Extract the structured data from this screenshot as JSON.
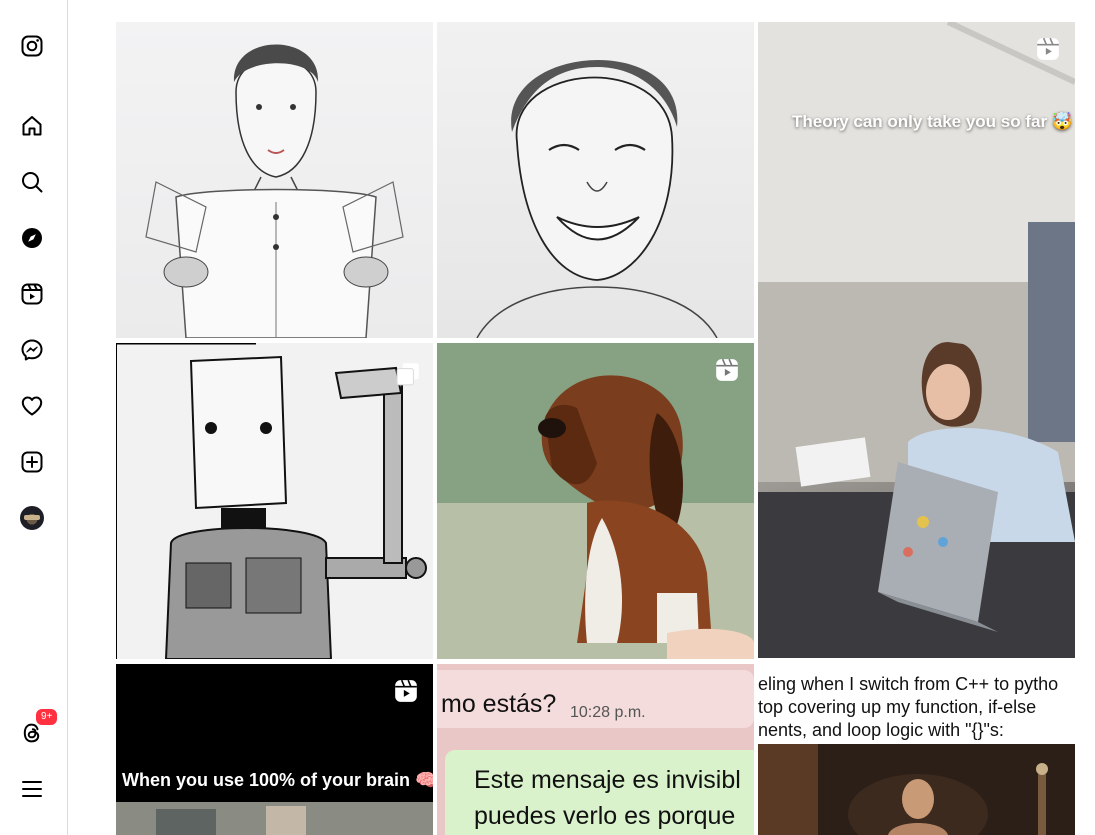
{
  "nav": {
    "notifications_badge": "9+"
  },
  "grid": {
    "tiles": [
      {
        "kind": "image"
      },
      {
        "kind": "image"
      },
      {
        "kind": "reel",
        "overlay_text": "Theory can only take you so far 🤯"
      },
      {
        "kind": "carousel"
      },
      {
        "kind": "reel"
      },
      {
        "kind": "reel",
        "overlay_text": "When you use 100% of your brain 🧠"
      },
      {
        "kind": "image",
        "chat_header": "mo estás?",
        "chat_time": "10:28 p.m.",
        "chat_line1": "Este mensaje es invisibl",
        "chat_line2": "puedes verlo es porque"
      },
      {
        "kind": "image",
        "caption_line1": "eling when I switch from C++ to pytho",
        "caption_line2": "top covering up my function, if-else",
        "caption_line3": "nents, and loop logic with \"{}\"s:"
      }
    ]
  },
  "colors": {
    "badge": "#ff3040",
    "border": "#dbdbdb",
    "icon": "#000000"
  }
}
